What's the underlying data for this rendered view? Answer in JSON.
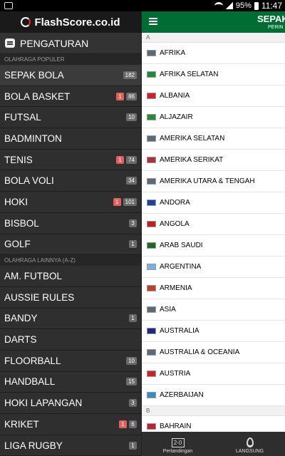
{
  "status_bar": {
    "battery": "95%",
    "time": "11:47"
  },
  "drawer": {
    "logo": "FlashScore.co.id",
    "settings_label": "PENGATURAN",
    "section_popular": "OLAHRAGA POPULER",
    "section_other": "OLAHRAGA LAINNYA (A-Z)",
    "popular": [
      {
        "label": "SEPAK BOLA",
        "count": "182",
        "live": ""
      },
      {
        "label": "BOLA BASKET",
        "count": "86",
        "live": "1"
      },
      {
        "label": "FUTSAL",
        "count": "10",
        "live": ""
      },
      {
        "label": "BADMINTON",
        "count": "",
        "live": ""
      },
      {
        "label": "TENIS",
        "count": "74",
        "live": "1"
      },
      {
        "label": "BOLA VOLI",
        "count": "34",
        "live": ""
      },
      {
        "label": "HOKI",
        "count": "101",
        "live": "1"
      },
      {
        "label": "BISBOL",
        "count": "3",
        "live": ""
      },
      {
        "label": "GOLF",
        "count": "1",
        "live": ""
      }
    ],
    "other": [
      {
        "label": "AM. FUTBOL",
        "count": "",
        "live": ""
      },
      {
        "label": "AUSSIE RULES",
        "count": "",
        "live": ""
      },
      {
        "label": "BANDY",
        "count": "1",
        "live": ""
      },
      {
        "label": "DARTS",
        "count": "",
        "live": ""
      },
      {
        "label": "FLOORBALL",
        "count": "10",
        "live": ""
      },
      {
        "label": "HANDBALL",
        "count": "15",
        "live": ""
      },
      {
        "label": "HOKI LAPANGAN",
        "count": "3",
        "live": ""
      },
      {
        "label": "KRIKET",
        "count": "6",
        "live": "1"
      },
      {
        "label": "LIGA RUGBY",
        "count": "1",
        "live": ""
      }
    ]
  },
  "main": {
    "title": "SEPAK",
    "subtitle": "PERIN",
    "letter_a": "A",
    "letter_b": "B",
    "countries_a": [
      {
        "name": "AFRIKA",
        "flag": "#5a6a7a"
      },
      {
        "name": "AFRIKA SELATAN",
        "flag": "#1d8a3a"
      },
      {
        "name": "ALBANIA",
        "flag": "#d0202a"
      },
      {
        "name": "ALJAZAIR",
        "flag": "#2a8a3a"
      },
      {
        "name": "AMERIKA SELATAN",
        "flag": "#5a6a7a"
      },
      {
        "name": "AMERIKA SERIKAT",
        "flag": "#b0303a"
      },
      {
        "name": "AMERIKA UTARA & TENGAH",
        "flag": "#5a6a7a"
      },
      {
        "name": "ANDORA",
        "flag": "#2040a0"
      },
      {
        "name": "ANGOLA",
        "flag": "#c02020"
      },
      {
        "name": "ARAB SAUDI",
        "flag": "#1a6a2a"
      },
      {
        "name": "ARGENTINA",
        "flag": "#7ab0e0"
      },
      {
        "name": "ARMENIA",
        "flag": "#c0402a"
      },
      {
        "name": "ASIA",
        "flag": "#5a6a7a"
      },
      {
        "name": "AUSTRALIA",
        "flag": "#1a2a80"
      },
      {
        "name": "AUSTRALIA & OCEANIA",
        "flag": "#5a6a7a"
      },
      {
        "name": "AUSTRIA",
        "flag": "#d02030"
      },
      {
        "name": "AZERBAIJAN",
        "flag": "#3a8ac0"
      }
    ],
    "countries_b": [
      {
        "name": "BAHRAIN",
        "flag": "#c02030"
      }
    ],
    "tab_matches": "Pertandingan",
    "tab_live": "LANGSUNG",
    "score_icon_text": "2-0"
  }
}
